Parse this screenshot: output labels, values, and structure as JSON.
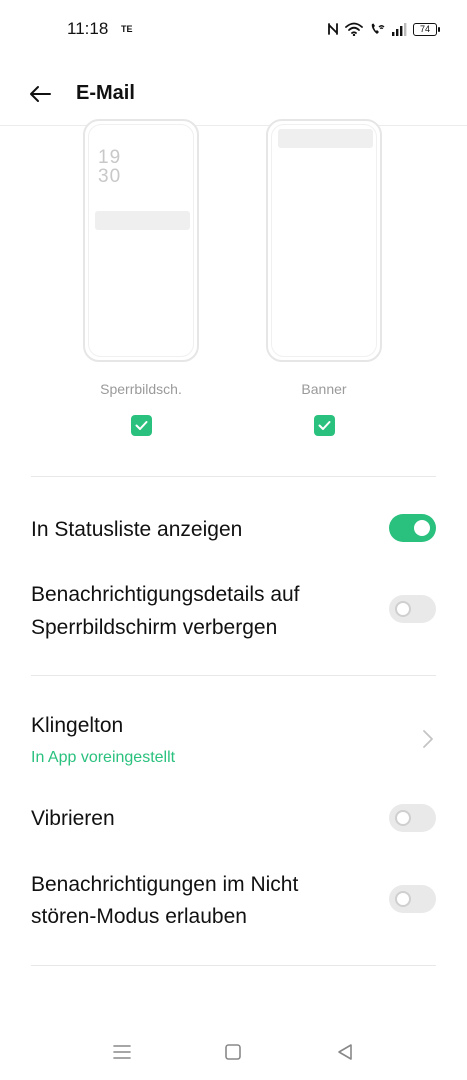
{
  "status_bar": {
    "time": "11:18",
    "carrier": "TE",
    "battery": "74",
    "icons": [
      "nfc-icon",
      "wifi-icon",
      "wifi-calling-icon",
      "signal-icon",
      "battery-icon"
    ]
  },
  "app_bar": {
    "title": "E-Mail",
    "back_icon": "arrow-left-icon"
  },
  "preview": {
    "lock_clock_hours": "19",
    "lock_clock_minutes": "30",
    "options": [
      {
        "label": "Sperrbildsch.",
        "checked": true
      },
      {
        "label": "Banner",
        "checked": true
      }
    ]
  },
  "settings": {
    "status_list": {
      "label": "In Statusliste anzeigen",
      "enabled": true
    },
    "hide_details": {
      "label_line1": "Benachrichtigungsdetails auf",
      "label_line2": "Sperrbildschirm verbergen",
      "enabled": false
    },
    "ringtone": {
      "label": "Klingelton",
      "value": "In App voreingestellt"
    },
    "vibrate": {
      "label": "Vibrieren",
      "enabled": false
    },
    "dnd": {
      "label_line1": "Benachrichtigungen im Nicht",
      "label_line2": "stören-Modus erlauben",
      "enabled": false
    }
  },
  "colors": {
    "accent": "#2ac17e",
    "toggle_off": "#e9e9e9",
    "divider": "#e8e8e8"
  },
  "nav_bar": {
    "icons": [
      "menu-icon",
      "home-icon",
      "back-triangle-icon"
    ]
  }
}
